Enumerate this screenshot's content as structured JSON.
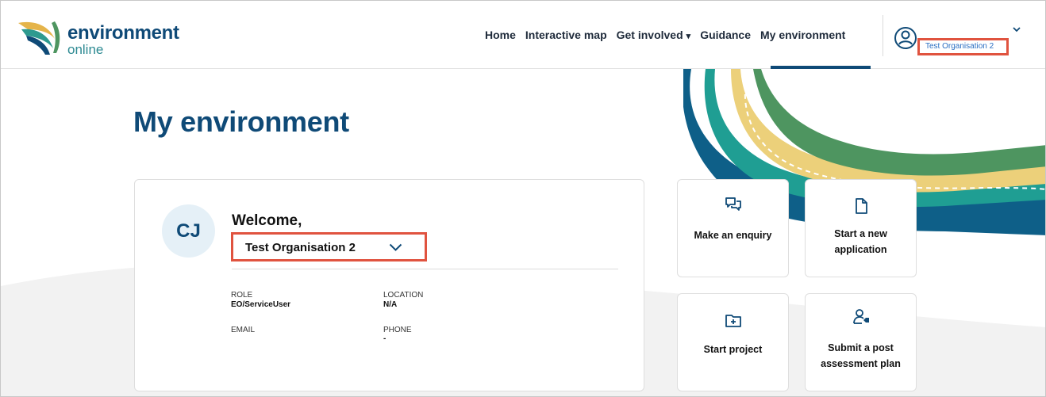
{
  "brand": {
    "title": "environment",
    "subtitle": "online"
  },
  "nav": {
    "items": [
      {
        "label": "Home"
      },
      {
        "label": "Interactive map"
      },
      {
        "label": "Get involved",
        "caret": "▾"
      },
      {
        "label": "Guidance"
      },
      {
        "label": "My environment"
      }
    ],
    "active": "My environment"
  },
  "user_menu": {
    "organisation": "Test Organisation 2"
  },
  "page": {
    "title": "My environment"
  },
  "profile": {
    "initials": "CJ",
    "welcome": "Welcome,",
    "organisation_selected": "Test Organisation 2",
    "fields": {
      "role_label": "ROLE",
      "role_value": "EO/ServiceUser",
      "location_label": "LOCATION",
      "location_value": "N/A",
      "email_label": "EMAIL",
      "email_value": "",
      "phone_label": "PHONE",
      "phone_value": "-"
    }
  },
  "tiles": {
    "enquiry": {
      "label": "Make an enquiry",
      "icon": "chat-bubbles-icon"
    },
    "new_application": {
      "label_line1": "Start a new",
      "label_line2": "application",
      "icon": "document-icon"
    },
    "start_project": {
      "label": "Start project",
      "icon": "folder-plus-icon"
    },
    "post_assessment": {
      "label_line1": "Submit a post",
      "label_line2": "assessment plan",
      "icon": "user-tag-icon"
    }
  },
  "colors": {
    "brand_navy": "#0f4a77",
    "highlight_red": "#e0533f",
    "wave_blue": "#0e5f88",
    "wave_teal": "#1f9e93",
    "wave_yellow": "#ecd07a",
    "wave_green": "#4e9560",
    "link_blue": "#2a6ec2"
  }
}
